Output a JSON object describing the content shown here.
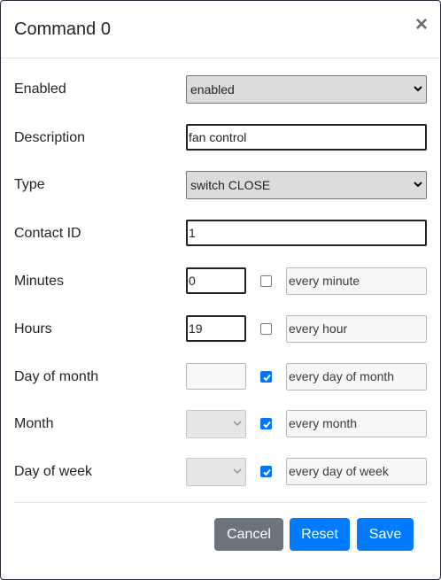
{
  "modal": {
    "title": "Command 0",
    "close_symbol": "×"
  },
  "form": {
    "enabled": {
      "label": "Enabled",
      "selected": "enabled"
    },
    "description": {
      "label": "Description",
      "value": "fan control"
    },
    "type": {
      "label": "Type",
      "selected": "switch CLOSE"
    },
    "contact_id": {
      "label": "Contact ID",
      "value": "1"
    },
    "minutes": {
      "label": "Minutes",
      "value": "0",
      "every_checked": false,
      "every_text": "every minute"
    },
    "hours": {
      "label": "Hours",
      "value": "19",
      "every_checked": false,
      "every_text": "every hour"
    },
    "day_of_month": {
      "label": "Day of month",
      "value": "",
      "every_checked": true,
      "every_text": "every day of month"
    },
    "month": {
      "label": "Month",
      "value": "",
      "every_checked": true,
      "every_text": "every month"
    },
    "day_of_week": {
      "label": "Day of week",
      "value": "",
      "every_checked": true,
      "every_text": "every day of week"
    }
  },
  "footer": {
    "cancel_label": "Cancel",
    "reset_label": "Reset",
    "save_label": "Save"
  },
  "colors": {
    "primary": "#007bff",
    "secondary": "#6c757d",
    "checkbox_checked": "#0075ff"
  }
}
